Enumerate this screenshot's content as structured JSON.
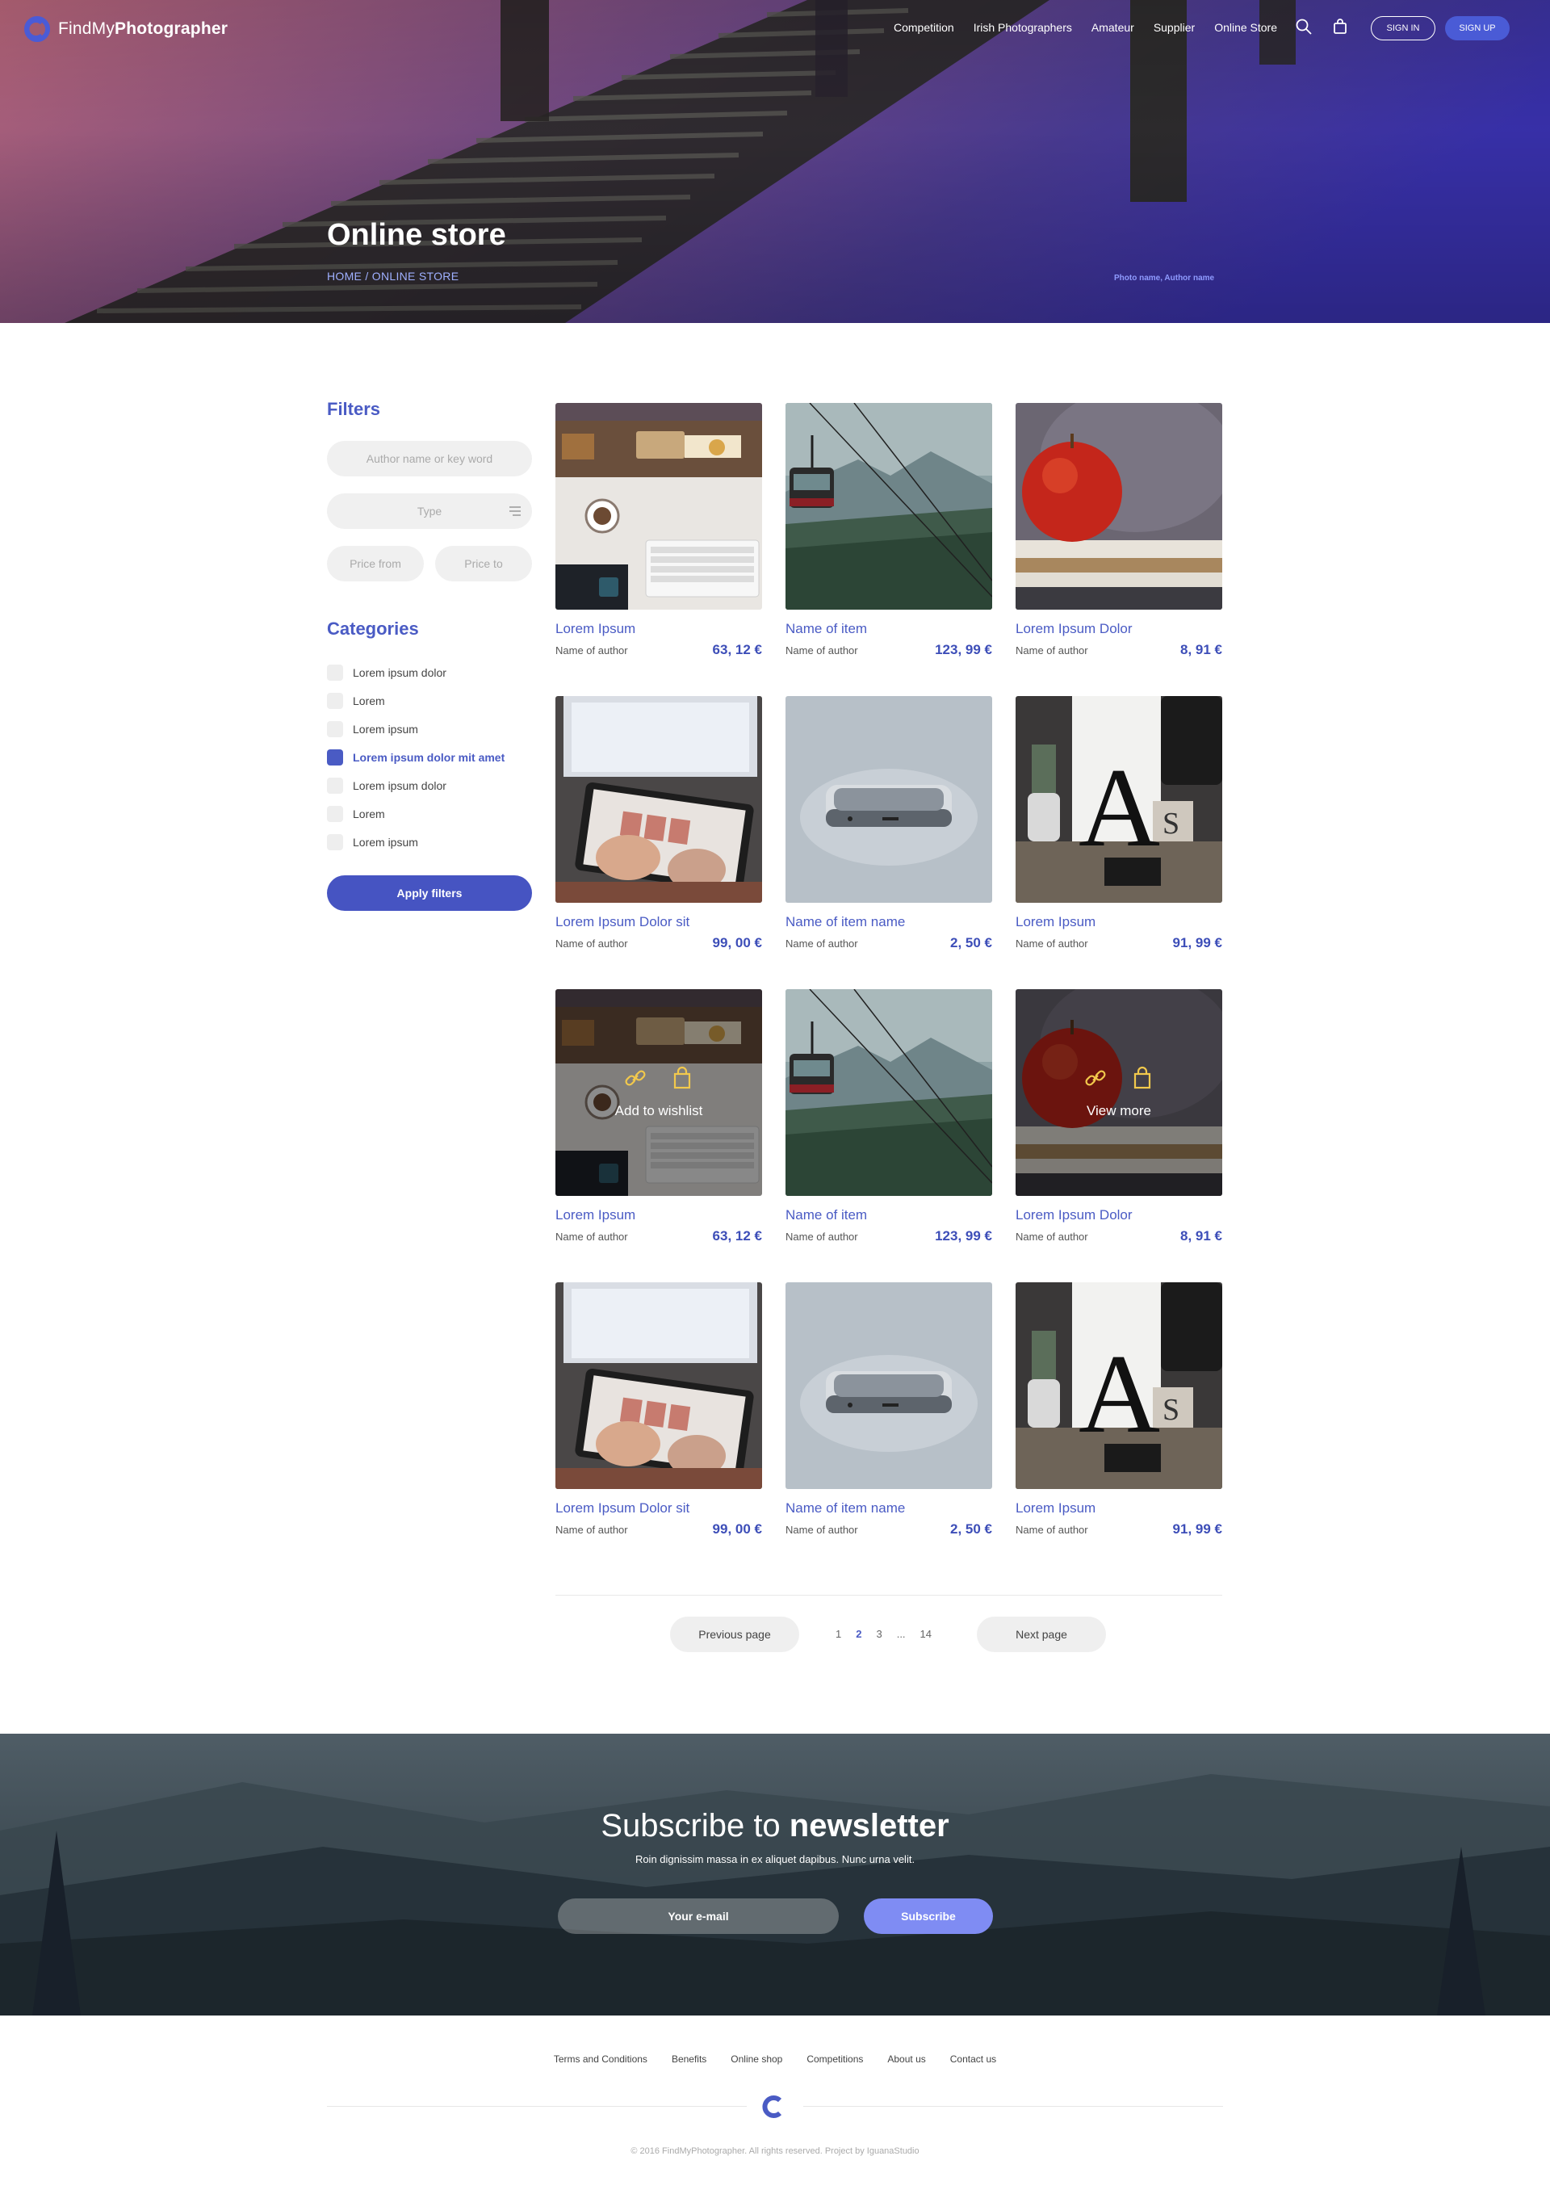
{
  "header": {
    "brand_regular": "FindMy",
    "brand_bold": "Photographer",
    "nav": [
      "Competition",
      "Irish Photographers",
      "Amateur",
      "Supplier",
      "Online Store"
    ],
    "sign_in": "SIGN IN",
    "sign_up": "SIGN UP"
  },
  "hero": {
    "title": "Online store",
    "breadcrumb": "HOME / ONLINE STORE",
    "photo_credit": "Photo name, Author name"
  },
  "filters": {
    "heading": "Filters",
    "author_placeholder": "Author name or key word",
    "type_label": "Type",
    "price_from": "Price from",
    "price_to": "Price to"
  },
  "categories": {
    "heading": "Categories",
    "items": [
      {
        "label": "Lorem ipsum dolor",
        "checked": false
      },
      {
        "label": "Lorem",
        "checked": false
      },
      {
        "label": "Lorem ipsum",
        "checked": false
      },
      {
        "label": "Lorem ipsum dolor mit amet",
        "checked": true
      },
      {
        "label": "Lorem ipsum dolor",
        "checked": false
      },
      {
        "label": "Lorem",
        "checked": false
      },
      {
        "label": "Lorem ipsum",
        "checked": false
      }
    ],
    "apply": "Apply filters"
  },
  "products": [
    {
      "title": "Lorem Ipsum",
      "author": "Name of author",
      "price": "63, 12 €"
    },
    {
      "title": "Name of item",
      "author": "Name of author",
      "price": "123, 99 €"
    },
    {
      "title": "Lorem Ipsum Dolor",
      "author": "Name of author",
      "price": "8, 91 €"
    },
    {
      "title": "Lorem Ipsum Dolor sit",
      "author": "Name of author",
      "price": "99, 00 €"
    },
    {
      "title": "Name of item name",
      "author": "Name of author",
      "price": "2, 50 €"
    },
    {
      "title": "Lorem Ipsum",
      "author": "Name of author",
      "price": "91, 99 €"
    },
    {
      "title": "Lorem Ipsum",
      "author": "Name of author",
      "price": "63, 12 €",
      "overlay": "Add to wishlist"
    },
    {
      "title": "Name of item",
      "author": "Name of author",
      "price": "123, 99 €"
    },
    {
      "title": "Lorem Ipsum Dolor",
      "author": "Name of author",
      "price": "8, 91 €",
      "overlay": "View more"
    },
    {
      "title": "Lorem Ipsum Dolor sit",
      "author": "Name of author",
      "price": "99, 00 €"
    },
    {
      "title": "Name of item name",
      "author": "Name of author",
      "price": "2, 50 €"
    },
    {
      "title": "Lorem Ipsum",
      "author": "Name of author",
      "price": "91, 99 €"
    }
  ],
  "pagination": {
    "prev": "Previous page",
    "next": "Next page",
    "pages": [
      "1",
      "2",
      "3",
      "...",
      "14"
    ],
    "current": "2"
  },
  "newsletter": {
    "title_regular": "Subscribe to ",
    "title_bold": "newsletter",
    "subtitle": "Roin dignissim massa in ex aliquet dapibus. Nunc urna velit.",
    "email_placeholder": "Your e-mail",
    "subscribe": "Subscribe"
  },
  "footer": {
    "links": [
      "Terms and Conditions",
      "Benefits",
      "Online shop",
      "Competitions",
      "About us",
      "Contact us"
    ],
    "copyright": "© 2016 FindMyPhotographer. All rights reserved. Project by IguanaStudio"
  },
  "colors": {
    "accent": "#4a5bc4",
    "signup_bg": "#4a5bd6",
    "subscribe_bg": "#7f8cf3"
  }
}
